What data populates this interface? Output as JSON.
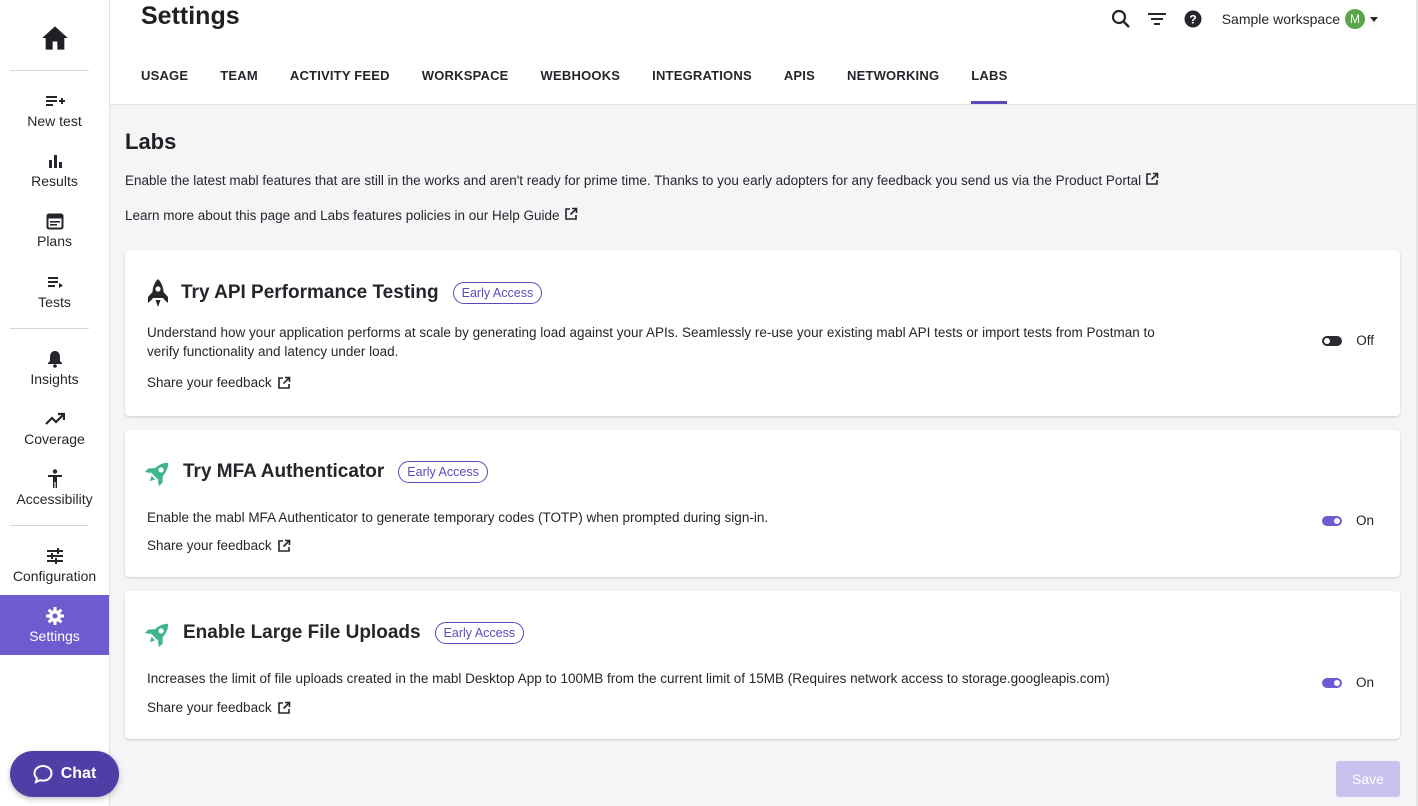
{
  "sidebar": {
    "items": [
      {
        "label": "New test",
        "icon": "new-test-icon"
      },
      {
        "label": "Results",
        "icon": "bar-chart-icon"
      },
      {
        "label": "Plans",
        "icon": "calendar-icon"
      },
      {
        "label": "Tests",
        "icon": "list-icon"
      },
      {
        "label": "Insights",
        "icon": "bell-icon"
      },
      {
        "label": "Coverage",
        "icon": "trending-up-icon"
      },
      {
        "label": "Accessibility",
        "icon": "accessibility-icon"
      },
      {
        "label": "Configuration",
        "icon": "sliders-icon"
      },
      {
        "label": "Settings",
        "icon": "gear-icon"
      }
    ],
    "active": "Settings",
    "chat_label": "Chat"
  },
  "header": {
    "title": "Settings",
    "workspace": "Sample workspace",
    "avatar_initial": "M",
    "tabs": [
      "USAGE",
      "TEAM",
      "ACTIVITY FEED",
      "WORKSPACE",
      "WEBHOOKS",
      "INTEGRATIONS",
      "APIS",
      "NETWORKING",
      "LABS"
    ],
    "active_tab": "LABS"
  },
  "main": {
    "title": "Labs",
    "intro_1": "Enable the latest mabl features that are still in the works and aren't ready for prime time. Thanks to you early adopters for any feedback you send us via the Product Portal",
    "intro_2": "Learn more about this page and Labs features policies in our Help Guide",
    "cards": [
      {
        "title": "Try API Performance Testing",
        "badge": "Early Access",
        "description": "Understand how your application performs at scale by generating load against your APIs. Seamlessly re-use your existing mabl API tests or import tests from Postman to verify functionality and latency under load.",
        "feedback": "Share your feedback",
        "state_label": "Off",
        "enabled": false
      },
      {
        "title": "Try MFA Authenticator",
        "badge": "Early Access",
        "description": "Enable the mabl MFA Authenticator to generate temporary codes (TOTP) when prompted during sign-in.",
        "feedback": "Share your feedback",
        "state_label": "On",
        "enabled": true
      },
      {
        "title": "Enable Large File Uploads",
        "badge": "Early Access",
        "description": "Increases the limit of file uploads created in the mabl Desktop App to 100MB from the current limit of 15MB (Requires network access to storage.googleapis.com)",
        "feedback": "Share your feedback",
        "state_label": "On",
        "enabled": true
      }
    ],
    "save_label": "Save"
  },
  "colors": {
    "accent": "#6c5ccf",
    "accent_dark": "#4d3fa6",
    "rocket_green": "#3fb58a",
    "save_disabled": "#c7c2ee"
  }
}
